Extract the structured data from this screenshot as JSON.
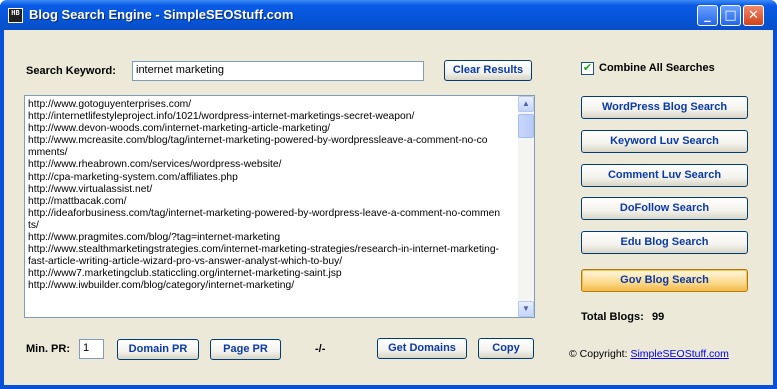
{
  "window": {
    "title": "Blog Search Engine - SimpleSEOStuff.com",
    "app_icon_text": "HB",
    "minimize_glyph": "_",
    "maximize_glyph": "□",
    "close_glyph": "✕"
  },
  "search": {
    "label": "Search Keyword:",
    "value": "internet marketing",
    "clear_label": "Clear Results"
  },
  "combine": {
    "label": "Combine All Searches",
    "checked": true,
    "check_glyph": "✔"
  },
  "side_buttons": {
    "wordpress": "WordPress Blog Search",
    "keywordluv": "Keyword Luv Search",
    "commentluv": "Comment Luv Search",
    "dofollow": "DoFollow Search",
    "edu": "Edu Blog Search",
    "gov": "Gov Blog Search"
  },
  "results": [
    "http://www.gotoguyenterprises.com/",
    "http://internetlifestyleproject.info/1021/wordpress-internet-marketings-secret-weapon/",
    "http://www.devon-woods.com/internet-marketing-article-marketing/",
    "http://www.mcreasite.com/blog/tag/internet-marketing-powered-by-wordpressleave-a-comment-no-co",
    "mments/",
    "http://www.rheabrown.com/services/wordpress-website/",
    "http://cpa-marketing-system.com/affiliates.php",
    "http://www.virtualassist.net/",
    "http://mattbacak.com/",
    "http://ideaforbusiness.com/tag/internet-marketing-powered-by-wordpress-leave-a-comment-no-commen",
    "ts/",
    "http://www.pragmites.com/blog/?tag=internet-marketing",
    "http://www.stealthmarketingstrategies.com/internet-marketing-strategies/research-in-internet-marketing-",
    "fast-article-writing-article-wizard-pro-vs-answer-analyst-which-to-buy/",
    "http://www7.marketingclub.staticcling.org/internet-marketing-saint.jsp",
    "http://www.iwbuilder.com/blog/category/internet-marketing/"
  ],
  "scroll": {
    "up_glyph": "▲",
    "down_glyph": "▼"
  },
  "total": {
    "label": "Total Blogs:",
    "value": "99"
  },
  "bottom": {
    "min_pr_label": "Min. PR:",
    "min_pr_value": "1",
    "domain_pr": "Domain PR",
    "page_pr": "Page PR",
    "status": "-/-",
    "get_domains": "Get Domains",
    "copy": "Copy"
  },
  "copyright": {
    "prefix": "© Copyright:",
    "link": "SimpleSEOStuff.com"
  }
}
